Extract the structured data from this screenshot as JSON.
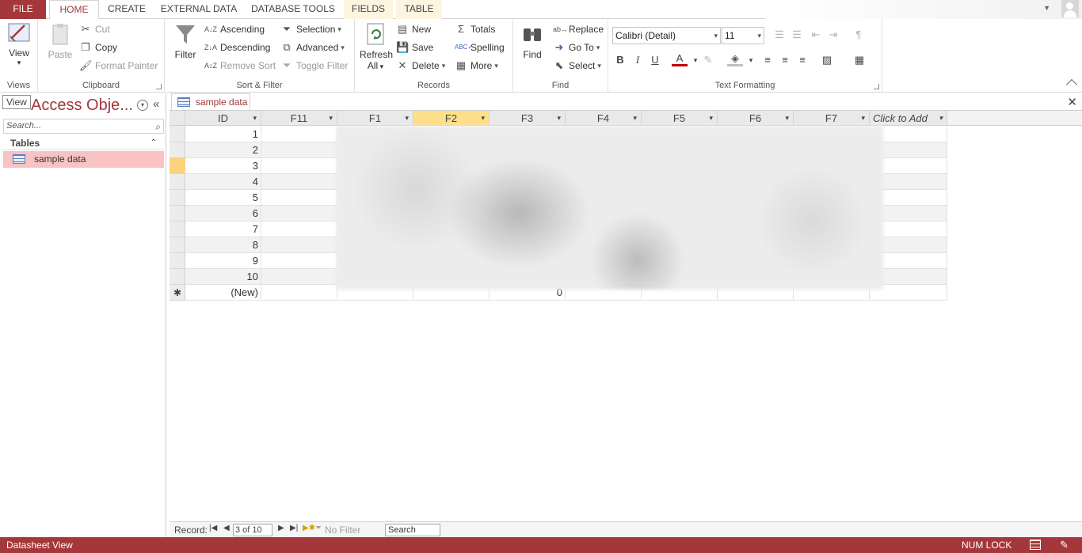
{
  "tabs": [
    "FILE",
    "HOME",
    "CREATE",
    "EXTERNAL DATA",
    "DATABASE TOOLS",
    "FIELDS",
    "TABLE"
  ],
  "ribbon": {
    "views": {
      "view_label": "View",
      "group_label": "Views"
    },
    "clipboard": {
      "paste": "Paste",
      "cut": "Cut",
      "copy": "Copy",
      "format_painter": "Format Painter",
      "group_label": "Clipboard"
    },
    "sort_filter": {
      "filter": "Filter",
      "ascending": "Ascending",
      "descending": "Descending",
      "remove_sort": "Remove Sort",
      "selection": "Selection",
      "advanced": "Advanced",
      "toggle_filter": "Toggle Filter",
      "group_label": "Sort & Filter"
    },
    "records": {
      "refresh": "Refresh",
      "refresh_all": "All",
      "new": "New",
      "save": "Save",
      "delete": "Delete",
      "totals": "Totals",
      "spelling": "Spelling",
      "more": "More",
      "group_label": "Records"
    },
    "find": {
      "find": "Find",
      "replace": "Replace",
      "goto": "Go To",
      "select": "Select",
      "group_label": "Find"
    },
    "text_formatting": {
      "font": "Calibri (Detail)",
      "size": "11",
      "bold": "B",
      "italic": "I",
      "underline": "U",
      "group_label": "Text Formatting"
    }
  },
  "nav": {
    "tooltip": "View",
    "title": "Access Obje...",
    "search_placeholder": "Search...",
    "section": "Tables",
    "item": "sample data"
  },
  "doc": {
    "tab": "sample data",
    "columns": [
      "ID",
      "F11",
      "F1",
      "F2",
      "F3",
      "F4",
      "F5",
      "F6",
      "F7",
      "Click to Add"
    ],
    "ids": [
      "1",
      "2",
      "3",
      "4",
      "5",
      "6",
      "7",
      "8",
      "9",
      "10"
    ],
    "new_label": "(New)",
    "new_f3": "0"
  },
  "recnav": {
    "label": "Record:",
    "position": "3 of 10",
    "no_filter": "No Filter",
    "search": "Search"
  },
  "status": {
    "left": "Datasheet View",
    "numlock": "NUM LOCK"
  },
  "colors": {
    "accent": "#a4373a",
    "selected_header": "#fde089",
    "nav_selected": "#f9c3c3"
  }
}
